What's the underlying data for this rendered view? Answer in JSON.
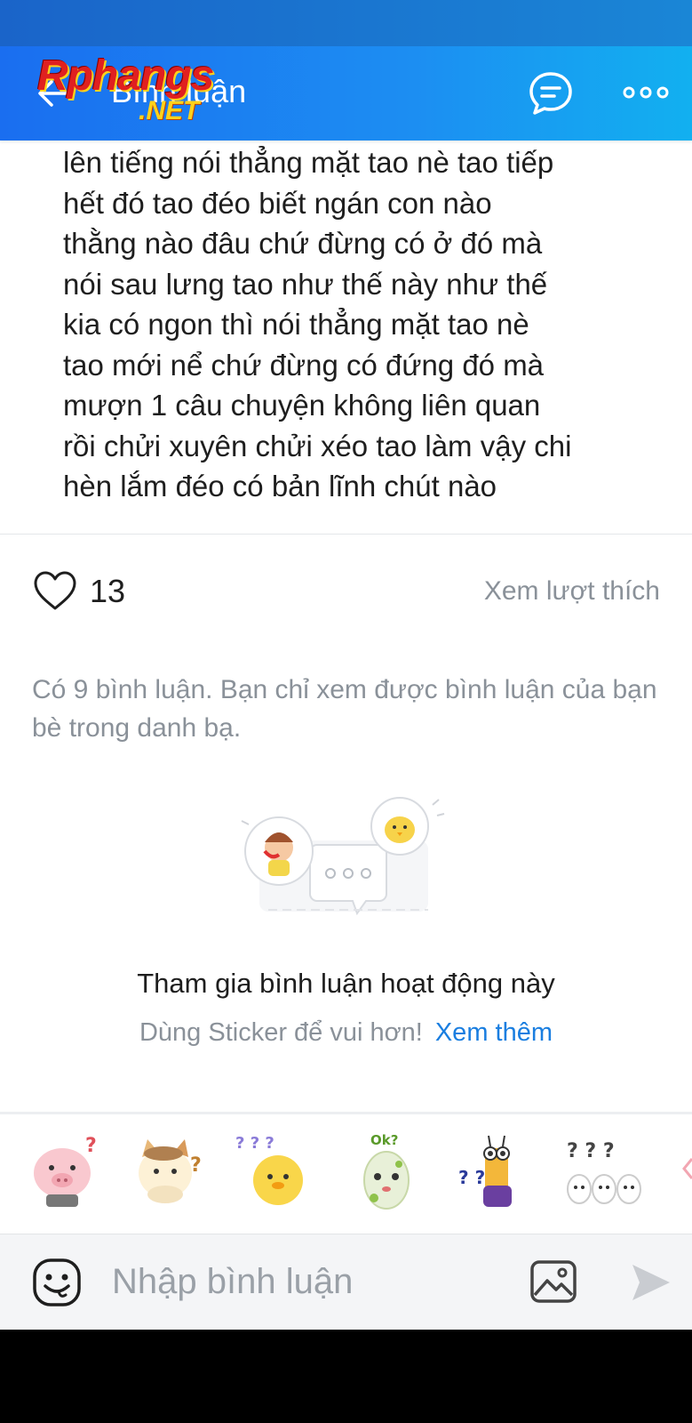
{
  "header": {
    "title": "Bình luận",
    "logo_text": "Rphangs",
    "logo_suffix": ".NET",
    "back_icon": "arrow-left-icon",
    "chat_icon": "chat-bubble-icon",
    "more_icon": "more-dots-icon"
  },
  "post": {
    "text": "lên tiếng nói thẳng mặt tao nè tao tiếp\nhết đó tao đéo biết ngán con nào\nthằng nào đâu chứ đừng có ở đó mà\nnói sau lưng tao như thế này như thế\nkia có ngon thì nói thẳng mặt tao nè\ntao mới nể chứ đừng có đứng đó mà\nmượn 1 câu chuyện không liên quan\nrồi chửi xuyên chửi xéo tao làm vậy chi\nhèn lắm đéo có bản lĩnh chút nào"
  },
  "likes": {
    "count": "13",
    "see_likes_label": "Xem lượt thích",
    "heart_icon": "heart-outline-icon"
  },
  "comments": {
    "note": "Có 9 bình luận. Bạn chỉ xem được bình luận của bạn bè trong danh bạ."
  },
  "empty_state": {
    "title": "Tham gia bình luận hoạt động này",
    "subtitle": "Dùng Sticker để vui hơn!",
    "see_more_label": "Xem thêm"
  },
  "stickers": [
    {
      "icon": "pig-question-sticker",
      "label": "?"
    },
    {
      "icon": "cat-question-sticker",
      "label": "?"
    },
    {
      "icon": "chick-question-sticker",
      "label": "? ? ?"
    },
    {
      "icon": "egg-ok-sticker",
      "label": "Ok?"
    },
    {
      "icon": "giraffe-question-sticker",
      "label": "? ?"
    },
    {
      "icon": "bunnies-question-sticker",
      "label": "? ? ?"
    }
  ],
  "composer": {
    "placeholder": "Nhập bình luận",
    "emoji_icon": "emoji-icon",
    "image_icon": "image-icon",
    "send_icon": "send-icon"
  },
  "colors": {
    "header_start": "#1a6ef0",
    "header_end": "#12b0f0",
    "link_blue": "#1a7ee0",
    "muted_gray": "#8a9199"
  }
}
